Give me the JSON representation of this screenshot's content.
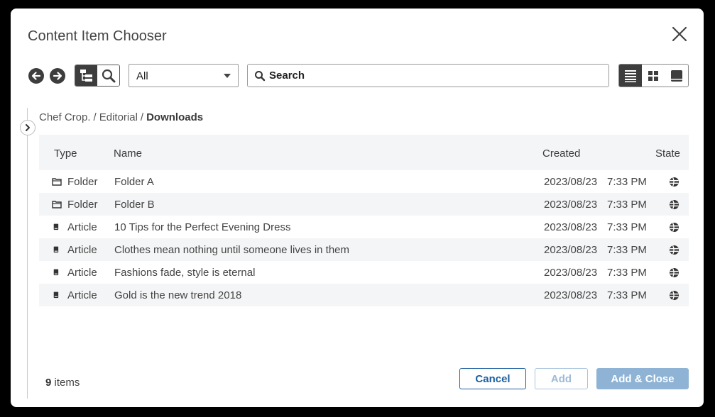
{
  "dialog": {
    "title": "Content Item Chooser"
  },
  "toolbar": {
    "type_filter": "All",
    "search_placeholder": "Search"
  },
  "breadcrumb": {
    "items": [
      "Chef Crop.",
      "Editorial"
    ],
    "current": "Downloads"
  },
  "table": {
    "columns": {
      "type": "Type",
      "name": "Name",
      "created": "Created",
      "state": "State"
    },
    "rows": [
      {
        "icon": "folder-icon",
        "type": "Folder",
        "name": "Folder A",
        "date": "2023/08/23",
        "time": "7:33 PM",
        "state_icon": "published-state-icon"
      },
      {
        "icon": "folder-icon",
        "type": "Folder",
        "name": "Folder B",
        "date": "2023/08/23",
        "time": "7:33 PM",
        "state_icon": "published-state-icon"
      },
      {
        "icon": "article-icon",
        "type": "Article",
        "name": "10 Tips for the Perfect Evening Dress",
        "date": "2023/08/23",
        "time": "7:33 PM",
        "state_icon": "published-state-icon"
      },
      {
        "icon": "article-icon",
        "type": "Article",
        "name": "Clothes mean nothing until someone lives in them",
        "date": "2023/08/23",
        "time": "7:33 PM",
        "state_icon": "published-state-icon"
      },
      {
        "icon": "article-icon",
        "type": "Article",
        "name": "Fashions fade, style is eternal",
        "date": "2023/08/23",
        "time": "7:33 PM",
        "state_icon": "published-state-icon"
      },
      {
        "icon": "article-icon",
        "type": "Article",
        "name": "Gold is the new trend 2018",
        "date": "2023/08/23",
        "time": "7:33 PM",
        "state_icon": "published-state-icon"
      }
    ]
  },
  "footer": {
    "count": "9",
    "count_label": "items",
    "cancel": "Cancel",
    "add": "Add",
    "add_close": "Add & Close"
  },
  "colors": {
    "primary": "#1d5fa0",
    "disabled_primary": "#8fb3d5",
    "active_toggle": "#3d3d3d",
    "stripe": "#f4f5f6"
  }
}
